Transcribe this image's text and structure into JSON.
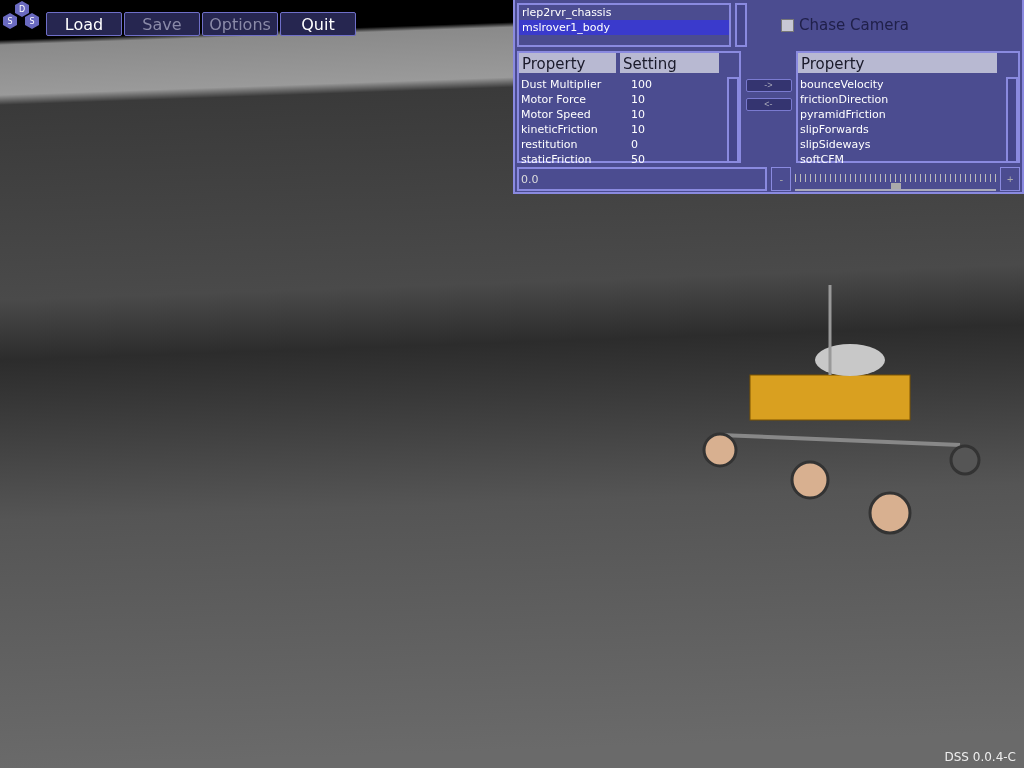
{
  "toolbar": {
    "logo_letters": [
      "D",
      "S",
      "S"
    ],
    "buttons": [
      {
        "label": "Load",
        "disabled": false
      },
      {
        "label": "Save",
        "disabled": true
      },
      {
        "label": "Options",
        "disabled": true
      },
      {
        "label": "Quit",
        "disabled": false
      }
    ]
  },
  "panel": {
    "objects": [
      {
        "label": "rlep2rvr_chassis",
        "selected": false
      },
      {
        "label": "mslrover1_body",
        "selected": true
      }
    ],
    "chase_camera": {
      "label": "Chase Camera",
      "checked": false
    },
    "left_table": {
      "columns": [
        "Property",
        "Setting"
      ],
      "rows": [
        [
          "Dust Multiplier",
          "100"
        ],
        [
          "Motor Force",
          "10"
        ],
        [
          "Motor Speed",
          "10"
        ],
        [
          "kineticFriction",
          "10"
        ],
        [
          "restitution",
          "0"
        ],
        [
          "staticFriction",
          "50"
        ]
      ]
    },
    "transfer_buttons": [
      "->",
      "<-"
    ],
    "right_table": {
      "columns": [
        "Property"
      ],
      "rows": [
        "bounceVelocity",
        "frictionDirection",
        "pyramidFriction",
        "slipForwards",
        "slipSideways",
        "softCFM"
      ]
    },
    "value_field": {
      "value": "0.0"
    },
    "slider": {
      "decrement": "-",
      "increment": "+",
      "level": 0.5
    }
  },
  "version": "DSS 0.0.4-C"
}
